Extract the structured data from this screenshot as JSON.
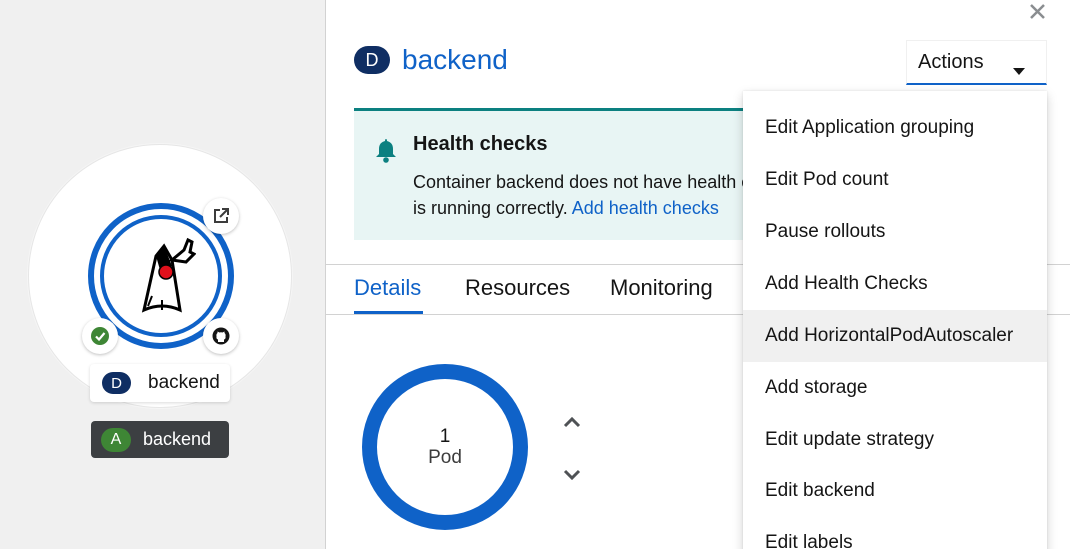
{
  "topology": {
    "node_label": {
      "badge": "D",
      "name": "backend"
    },
    "app_group": {
      "badge": "A",
      "name": "backend"
    },
    "icons": {
      "status": "check-circle-icon",
      "source": "github-icon",
      "open_url": "external-link-icon",
      "runtime": "java-duke-icon"
    }
  },
  "panel": {
    "title_badge": "D",
    "title": "backend",
    "actions_label": "Actions",
    "alert": {
      "title": "Health checks",
      "body_line1": "Container backend does not have health c",
      "body_line2_prefix": "is running correctly. ",
      "link": "Add health checks"
    },
    "tabs": [
      {
        "label": "Details",
        "active": true
      },
      {
        "label": "Resources",
        "active": false
      },
      {
        "label": "Monitoring",
        "active": false
      }
    ],
    "pod": {
      "count": "1",
      "label": "Pod"
    }
  },
  "menu": {
    "items": [
      {
        "label": "Edit Application grouping"
      },
      {
        "label": "Edit Pod count"
      },
      {
        "label": "Pause rollouts"
      },
      {
        "label": "Add Health Checks"
      },
      {
        "label": "Add HorizontalPodAutoscaler",
        "hover": true
      },
      {
        "label": "Add storage"
      },
      {
        "label": "Edit update strategy"
      },
      {
        "label": "Edit backend"
      },
      {
        "label": "Edit labels"
      }
    ]
  },
  "colors": {
    "accent": "#0f62c8",
    "badge_dark": "#0f2e63",
    "success": "#3e8635",
    "alert_bg": "#e8f5f4",
    "alert_border": "#0c8080"
  }
}
